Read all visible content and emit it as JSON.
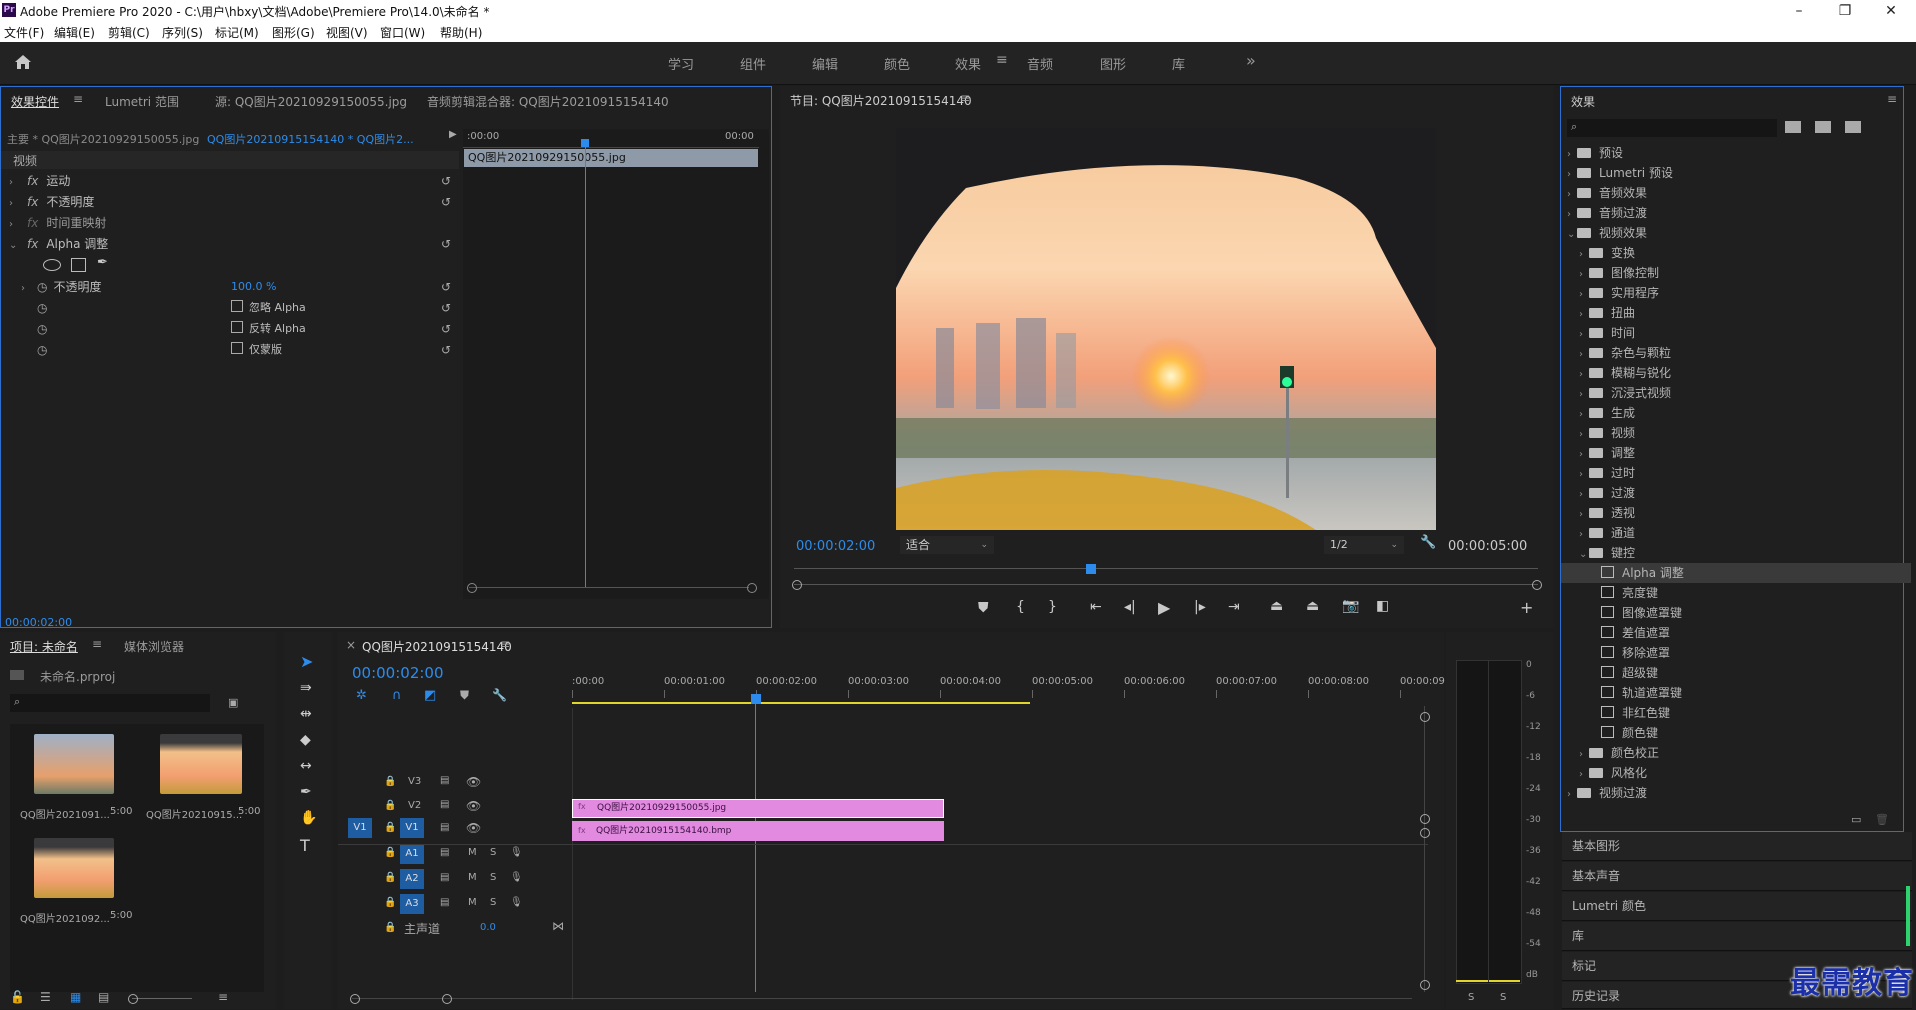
{
  "app": {
    "title": "Adobe Premiere Pro 2020 - C:\\用户\\hbxy\\文档\\Adobe\\Premiere Pro\\14.0\\未命名 *",
    "logo": "Pr"
  },
  "window_controls": {
    "minimize": "–",
    "maximize": "❐",
    "close": "✕"
  },
  "menu": [
    "文件(F)",
    "编辑(E)",
    "剪辑(C)",
    "序列(S)",
    "标记(M)",
    "图形(G)",
    "视图(V)",
    "窗口(W)",
    "帮助(H)"
  ],
  "workspaces": {
    "items": [
      "学习",
      "组件",
      "编辑",
      "颜色",
      "效果",
      "音频",
      "图形",
      "库"
    ],
    "active": "效果",
    "more": "»"
  },
  "effect_controls": {
    "tabs": [
      "效果控件",
      "Lumetri 范围",
      "源: QQ图片20210929150055.jpg",
      "音频剪辑混合器: QQ图片20210915154140"
    ],
    "source_label": "主要 * QQ图片20210929150055.jpg",
    "sequence_label": "QQ图片20210915154140 * QQ图片2...",
    "time_start": ":00:00",
    "time_end": "00:00",
    "clip_name": "QQ图片20210929150055.jpg",
    "section": "视频",
    "effects": [
      "运动",
      "不透明度",
      "时间重映射",
      "Alpha 调整"
    ],
    "param_opacity_label": "不透明度",
    "param_opacity_value": "100.0 %",
    "checkbox_ignore": "忽略 Alpha",
    "checkbox_invert": "反转 Alpha",
    "checkbox_mask": "仅蒙版",
    "timecode": "00:00:02:00"
  },
  "program_monitor": {
    "title": "节目: QQ图片20210915154140",
    "timecode": "00:00:02:00",
    "fit": "适合",
    "resolution": "1/2",
    "duration": "00:00:05:00"
  },
  "effects_panel": {
    "title": "效果",
    "search_placeholder": "",
    "top_items": [
      "预设",
      "Lumetri 预设",
      "音频效果",
      "音频过渡",
      "视频效果"
    ],
    "video_effects": [
      "变换",
      "图像控制",
      "实用程序",
      "扭曲",
      "时间",
      "杂色与颗粒",
      "模糊与锐化",
      "沉浸式视频",
      "生成",
      "视频",
      "调整",
      "过时",
      "过渡",
      "透视",
      "通道",
      "键控"
    ],
    "keying": [
      "Alpha 调整",
      "亮度键",
      "图像遮罩键",
      "差值遮罩",
      "移除遮罩",
      "超级键",
      "轨道遮罩键",
      "非红色键",
      "颜色键"
    ],
    "after": [
      "颜色校正",
      "风格化"
    ],
    "last": "视频过渡",
    "selected": "Alpha 调整"
  },
  "docked_panels": [
    "基本图形",
    "基本声音",
    "Lumetri 颜色",
    "库",
    "标记",
    "历史记录"
  ],
  "project": {
    "tabs": [
      "项目: 未命名",
      "媒体浏览器"
    ],
    "file": "未命名.prproj",
    "items": [
      {
        "name": "QQ图片2021091...",
        "dur": "5:00"
      },
      {
        "name": "QQ图片20210915...",
        "dur": "5:00"
      },
      {
        "name": "QQ图片2021092...",
        "dur": "5:00"
      }
    ]
  },
  "timeline": {
    "title": "QQ图片20210915154140",
    "timecode": "00:00:02:00",
    "ruler": [
      ":00:00",
      "00:00:01:00",
      "00:00:02:00",
      "00:00:03:00",
      "00:00:04:00",
      "00:00:05:00",
      "00:00:06:00",
      "00:00:07:00",
      "00:00:08:00",
      "00:00:09:"
    ],
    "video_tracks": [
      "V3",
      "V2",
      "V1"
    ],
    "audio_tracks": [
      "A1",
      "A2",
      "A3"
    ],
    "source_patch": "V1",
    "master_label": "主声道",
    "master_value": "0.0",
    "clip_v2": "QQ图片20210929150055.jpg",
    "clip_v1": "QQ图片20210915154140.bmp",
    "mute": "M",
    "solo": "S"
  },
  "audio_meter": {
    "scale": [
      "0",
      "-6",
      "-12",
      "-18",
      "-24",
      "-30",
      "-36",
      "-42",
      "-48",
      "-54",
      "dB"
    ],
    "solo_left": "S",
    "solo_right": "S"
  },
  "watermark": "最需教育",
  "colors": {
    "accent": "#2d8ceb",
    "clip": "#e28ae0",
    "panel": "#1f1f1f",
    "selected": "#3a3a3a"
  }
}
